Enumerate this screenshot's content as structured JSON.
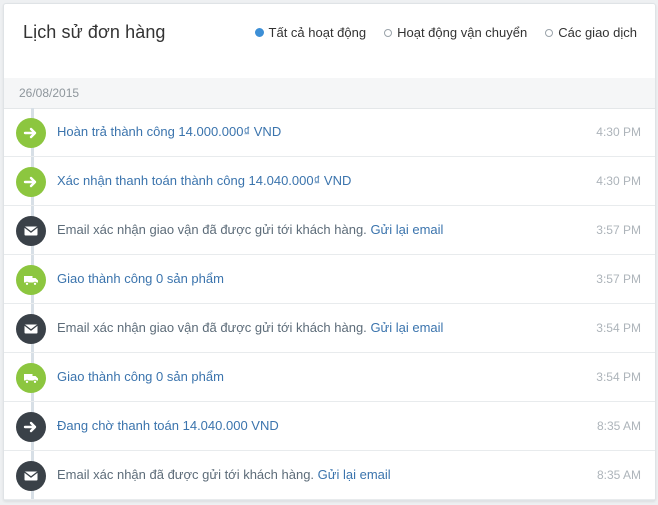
{
  "header": {
    "title": "Lịch sử đơn hàng",
    "filters": [
      {
        "label": "Tất cả hoạt động",
        "checked": true
      },
      {
        "label": "Hoạt động vận chuyển",
        "checked": false
      },
      {
        "label": "Các giao dịch",
        "checked": false
      }
    ]
  },
  "date_group": "26/08/2015",
  "colors": {
    "green": "#8cc63f",
    "dark": "#3a4148",
    "accent": "#3d8fd6",
    "link": "#3b74ad"
  },
  "events": [
    {
      "icon": "arrow-right-icon",
      "color": "green",
      "text": "Hoàn trả thành công 14.000.000₫ VND",
      "link": "",
      "muted": false,
      "time": "4:30 PM"
    },
    {
      "icon": "arrow-right-icon",
      "color": "green",
      "text": "Xác nhận thanh toán thành công 14.040.000₫ VND",
      "link": "",
      "muted": false,
      "time": "4:30 PM"
    },
    {
      "icon": "envelope-icon",
      "color": "dark",
      "text": "Email xác nhận giao vận đã được gửi tới khách hàng.",
      "link": "Gửi lại email",
      "muted": true,
      "time": "3:57 PM"
    },
    {
      "icon": "truck-icon",
      "color": "green",
      "text": "Giao thành công 0 sản phẩm",
      "link": "",
      "muted": false,
      "time": "3:57 PM"
    },
    {
      "icon": "envelope-icon",
      "color": "dark",
      "text": "Email xác nhận giao vận đã được gửi tới khách hàng.",
      "link": "Gửi lại email",
      "muted": true,
      "time": "3:54 PM"
    },
    {
      "icon": "truck-icon",
      "color": "green",
      "text": "Giao thành công 0 sản phẩm",
      "link": "",
      "muted": false,
      "time": "3:54 PM"
    },
    {
      "icon": "arrow-right-icon",
      "color": "dark",
      "text": "Đang chờ thanh toán 14.040.000 VND",
      "link": "",
      "muted": false,
      "time": "8:35 AM"
    },
    {
      "icon": "envelope-icon",
      "color": "dark",
      "text": "Email xác nhận đã được gửi tới khách hàng.",
      "link": "Gửi lại email",
      "muted": true,
      "time": "8:35 AM"
    }
  ]
}
